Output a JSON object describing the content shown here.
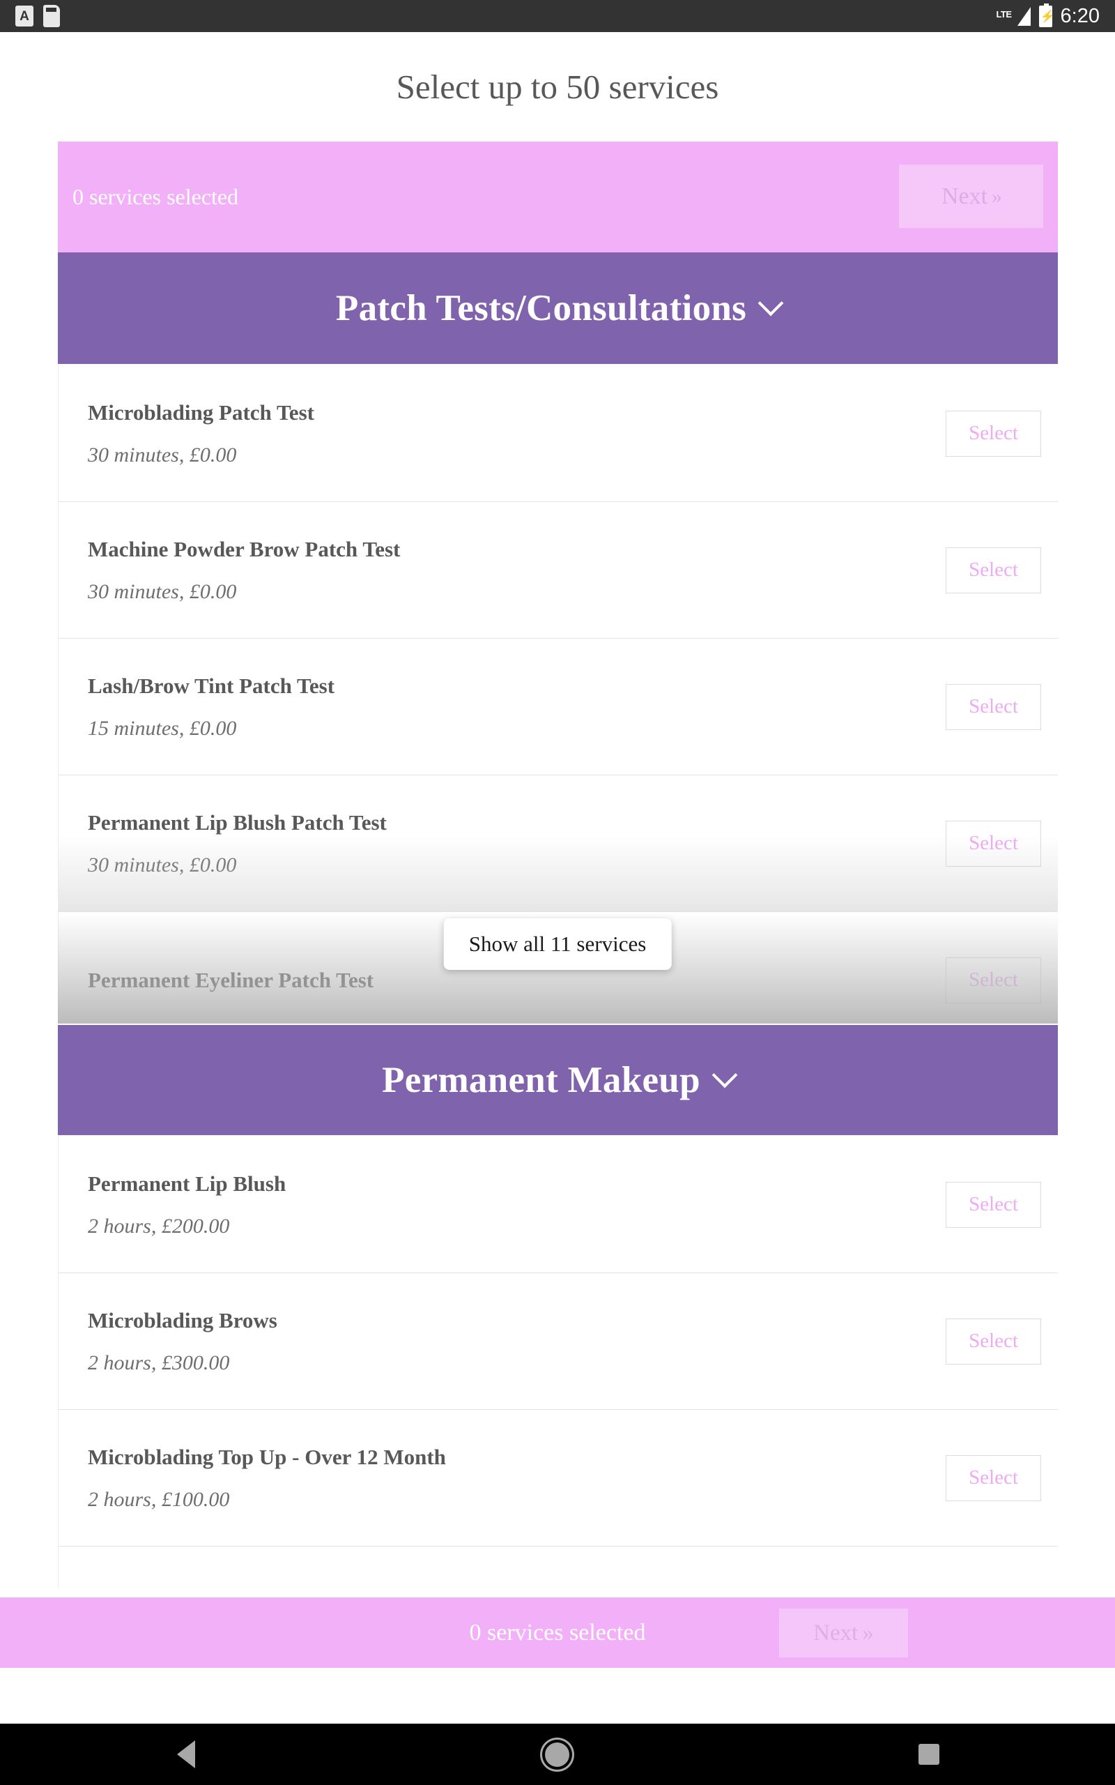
{
  "status_bar": {
    "icons_left": [
      "text-input-a-icon",
      "sim-card-icon"
    ],
    "network_label": "LTE",
    "signal_icon": "signal-bars-icon",
    "battery_icon": "battery-charging-icon",
    "battery_bolt": "⚡",
    "time": "6:20"
  },
  "page": {
    "title": "Select up to 50 services"
  },
  "selection_bar": {
    "status_text": "0 services selected",
    "next_label": "Next",
    "next_chevron": "»"
  },
  "sections": [
    {
      "title": "Patch Tests/Consultations",
      "chevron": "chevron-down-icon",
      "services": [
        {
          "name": "Microblading Patch Test",
          "meta": "30 minutes, £0.00",
          "action": "Select"
        },
        {
          "name": "Machine Powder Brow Patch Test",
          "meta": "30 minutes, £0.00",
          "action": "Select"
        },
        {
          "name": "Lash/Brow Tint Patch Test",
          "meta": "15 minutes, £0.00",
          "action": "Select"
        },
        {
          "name": "Permanent Lip Blush Patch Test",
          "meta": "30 minutes, £0.00",
          "action": "Select"
        }
      ],
      "hidden_service": {
        "name": "Permanent Eyeliner Patch Test",
        "action": "Select"
      },
      "show_all_label": "Show all 11 services"
    },
    {
      "title": "Permanent Makeup",
      "chevron": "chevron-down-icon",
      "services": [
        {
          "name": "Permanent Lip Blush",
          "meta": "2 hours, £200.00",
          "action": "Select"
        },
        {
          "name": "Microblading Brows",
          "meta": "2 hours, £300.00",
          "action": "Select"
        },
        {
          "name": "Microblading Top Up - Over 12 Month",
          "meta": "2 hours, £100.00",
          "action": "Select"
        }
      ]
    }
  ],
  "bottom_bar": {
    "status_text": "0 services selected",
    "next_label": "Next",
    "next_chevron": "»"
  },
  "nav_bar": {
    "back": "back-triangle-icon",
    "home": "home-circle-icon",
    "recents": "recents-square-icon"
  },
  "colors": {
    "pink": "#f2b0f8",
    "purple": "#7f63ad",
    "select_pink": "#eeaaf3",
    "text_gray": "#585858",
    "status_bar": "#333333"
  }
}
